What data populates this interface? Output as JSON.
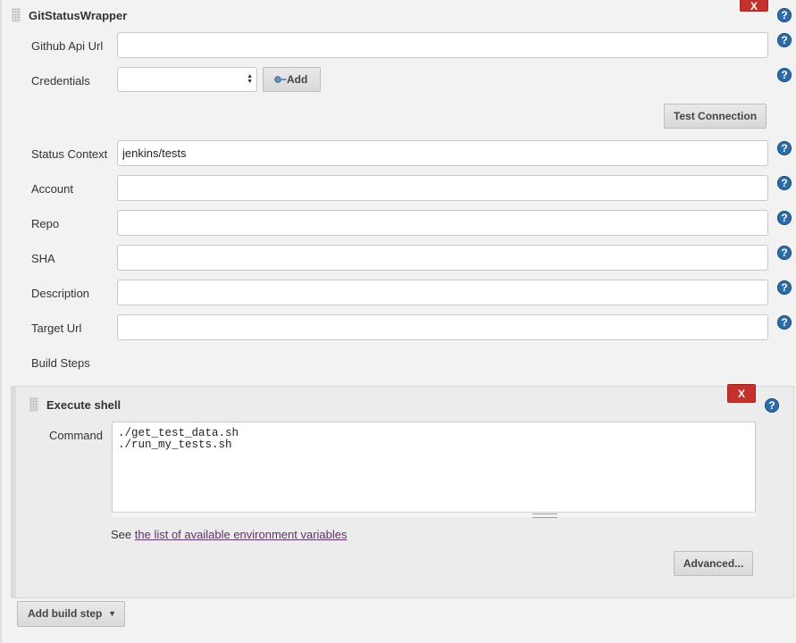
{
  "wrapper": {
    "title": "GitStatusWrapper",
    "delete_label": "X",
    "help_label": "?",
    "fields": {
      "github_api_url": {
        "label": "Github Api Url",
        "value": ""
      },
      "credentials": {
        "label": "Credentials",
        "value": ""
      },
      "status_context": {
        "label": "Status Context",
        "value": "jenkins/tests"
      },
      "account": {
        "label": "Account",
        "value": ""
      },
      "repo": {
        "label": "Repo",
        "value": ""
      },
      "sha": {
        "label": "SHA",
        "value": ""
      },
      "description": {
        "label": "Description",
        "value": ""
      },
      "target_url": {
        "label": "Target Url",
        "value": ""
      }
    },
    "add_button_label": "Add",
    "test_connection_label": "Test Connection",
    "build_steps_label": "Build Steps"
  },
  "execute_shell": {
    "title": "Execute shell",
    "delete_label": "X",
    "command_label": "Command",
    "command_value": "./get_test_data.sh\n./run_my_tests.sh",
    "see_text": "See",
    "env_link_text": "the list of available environment variables",
    "advanced_label": "Advanced..."
  },
  "add_build_step_label": "Add build step",
  "icons": {
    "drag_handle": "drag-handle-icon",
    "help": "help-icon",
    "key": "key-icon",
    "dropdown": "caret-down-icon"
  },
  "colors": {
    "delete_red": "#c4302b",
    "help_blue": "#2e6ca8",
    "link_purple": "#5c3566"
  }
}
